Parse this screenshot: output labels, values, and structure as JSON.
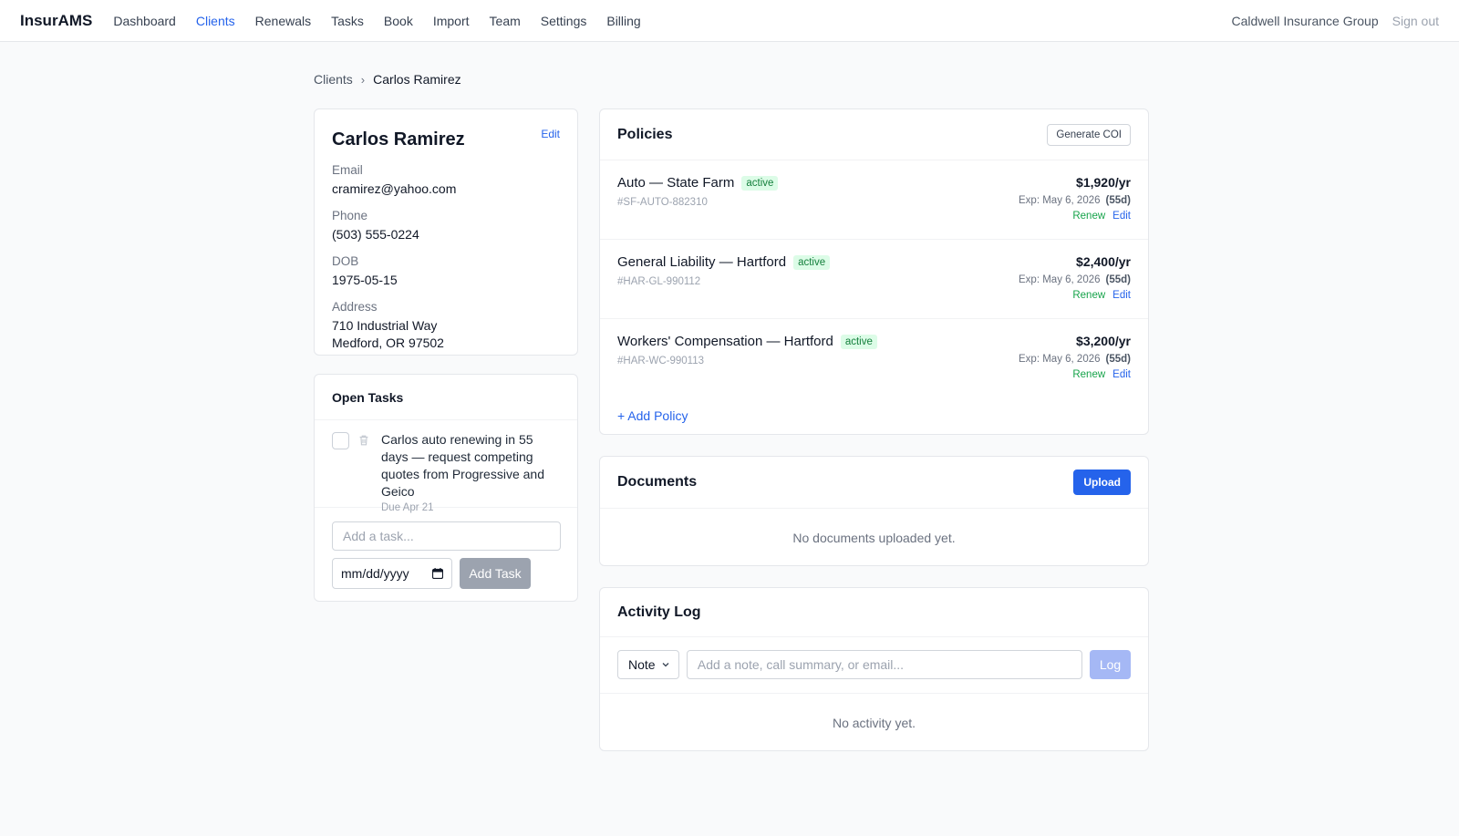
{
  "app": {
    "brand": "InsurAMS"
  },
  "nav": {
    "items": [
      {
        "label": "Dashboard",
        "active": false
      },
      {
        "label": "Clients",
        "active": true
      },
      {
        "label": "Renewals",
        "active": false
      },
      {
        "label": "Tasks",
        "active": false
      },
      {
        "label": "Book",
        "active": false
      },
      {
        "label": "Import",
        "active": false
      },
      {
        "label": "Team",
        "active": false
      },
      {
        "label": "Settings",
        "active": false
      },
      {
        "label": "Billing",
        "active": false
      }
    ],
    "org": "Caldwell Insurance Group",
    "signout": "Sign out"
  },
  "breadcrumb": {
    "parent": "Clients",
    "separator": "›",
    "current": "Carlos Ramirez"
  },
  "client": {
    "name": "Carlos Ramirez",
    "edit": "Edit",
    "email_label": "Email",
    "email": "cramirez@yahoo.com",
    "phone_label": "Phone",
    "phone": "(503) 555-0224",
    "dob_label": "DOB",
    "dob": "1975-05-15",
    "address_label": "Address",
    "address_line1": "710 Industrial Way",
    "address_line2": "Medford, OR 97502"
  },
  "tasks": {
    "title": "Open Tasks",
    "items": [
      {
        "text": "Carlos auto renewing in 55 days — request competing quotes from Progressive and Geico",
        "due": "Due Apr 21"
      }
    ],
    "input_placeholder": "Add a task...",
    "date_placeholder": "mm/dd/yyyy",
    "add_button": "Add Task"
  },
  "policies": {
    "title": "Policies",
    "generate_coi": "Generate COI",
    "items": [
      {
        "name": "Auto — State Farm",
        "status": "active",
        "number": "#SF-AUTO-882310",
        "premium": "$1,920/yr",
        "exp": "Exp: May 6, 2026",
        "days": "(55d)",
        "renew": "Renew",
        "edit": "Edit"
      },
      {
        "name": "General Liability — Hartford",
        "status": "active",
        "number": "#HAR-GL-990112",
        "premium": "$2,400/yr",
        "exp": "Exp: May 6, 2026",
        "days": "(55d)",
        "renew": "Renew",
        "edit": "Edit"
      },
      {
        "name": "Workers' Compensation — Hartford",
        "status": "active",
        "number": "#HAR-WC-990113",
        "premium": "$3,200/yr",
        "exp": "Exp: May 6, 2026",
        "days": "(55d)",
        "renew": "Renew",
        "edit": "Edit"
      }
    ],
    "add_policy": "+ Add Policy"
  },
  "documents": {
    "title": "Documents",
    "upload": "Upload",
    "empty": "No documents uploaded yet."
  },
  "activity": {
    "title": "Activity Log",
    "type_selected": "Note",
    "input_placeholder": "Add a note, call summary, or email...",
    "log_button": "Log",
    "empty": "No activity yet."
  },
  "colors": {
    "accent": "#2563eb",
    "active_badge_bg": "#dcfce7",
    "active_badge_text": "#15803d",
    "renew": "#16a34a"
  }
}
